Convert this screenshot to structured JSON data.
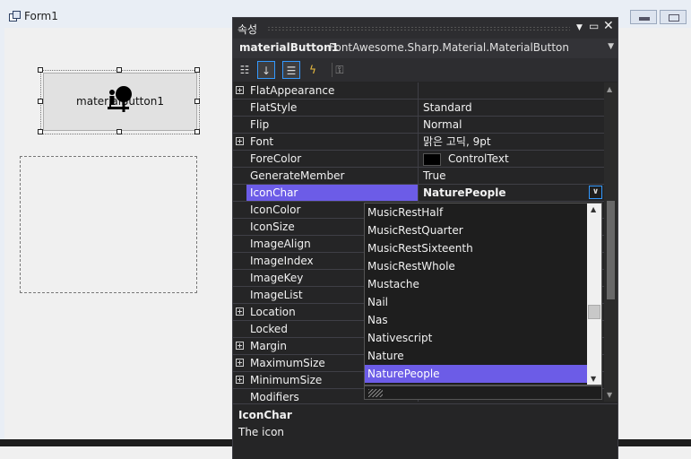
{
  "form": {
    "title": "Form1",
    "button_text": "materialButton1"
  },
  "properties": {
    "title": "속성",
    "object_name": "materialButton1",
    "object_type": "FontAwesome.Sharp.Material.MaterialButton",
    "rows": [
      {
        "name": "FlatAppearance",
        "value": "",
        "expandable": true
      },
      {
        "name": "FlatStyle",
        "value": "Standard",
        "expandable": false
      },
      {
        "name": "Flip",
        "value": "Normal",
        "expandable": false
      },
      {
        "name": "Font",
        "value": "맑은 고딕, 9pt",
        "expandable": true
      },
      {
        "name": "ForeColor",
        "value": "ControlText",
        "expandable": false,
        "swatch": "#000000"
      },
      {
        "name": "GenerateMember",
        "value": "True",
        "expandable": false
      },
      {
        "name": "IconChar",
        "value": "NaturePeople",
        "expandable": false,
        "selected": true
      },
      {
        "name": "IconColor",
        "value": "",
        "expandable": false
      },
      {
        "name": "IconSize",
        "value": "",
        "expandable": false
      },
      {
        "name": "ImageAlign",
        "value": "",
        "expandable": false
      },
      {
        "name": "ImageIndex",
        "value": "",
        "expandable": false
      },
      {
        "name": "ImageKey",
        "value": "",
        "expandable": false
      },
      {
        "name": "ImageList",
        "value": "",
        "expandable": false
      },
      {
        "name": "Location",
        "value": "",
        "expandable": true
      },
      {
        "name": "Locked",
        "value": "",
        "expandable": false
      },
      {
        "name": "Margin",
        "value": "",
        "expandable": true
      },
      {
        "name": "MaximumSize",
        "value": "",
        "expandable": true
      },
      {
        "name": "MinimumSize",
        "value": "",
        "expandable": true
      },
      {
        "name": "Modifiers",
        "value": "",
        "expandable": false
      }
    ],
    "dropdown_items": [
      "MusicRestHalf",
      "MusicRestQuarter",
      "MusicRestSixteenth",
      "MusicRestWhole",
      "Mustache",
      "Nail",
      "Nas",
      "Nativescript",
      "Nature",
      "NaturePeople"
    ],
    "dropdown_selected": "NaturePeople",
    "description_title": "IconChar",
    "description_text": "The icon"
  },
  "colors": {
    "accent": "#6c5ce7",
    "panel_bg": "#252526",
    "focus_blue": "#3399ff"
  },
  "icons": [
    "form-icon",
    "nature-people-icon",
    "categorized-icon",
    "alphabetical-icon",
    "properties-icon",
    "events-icon",
    "property-pages-icon"
  ]
}
